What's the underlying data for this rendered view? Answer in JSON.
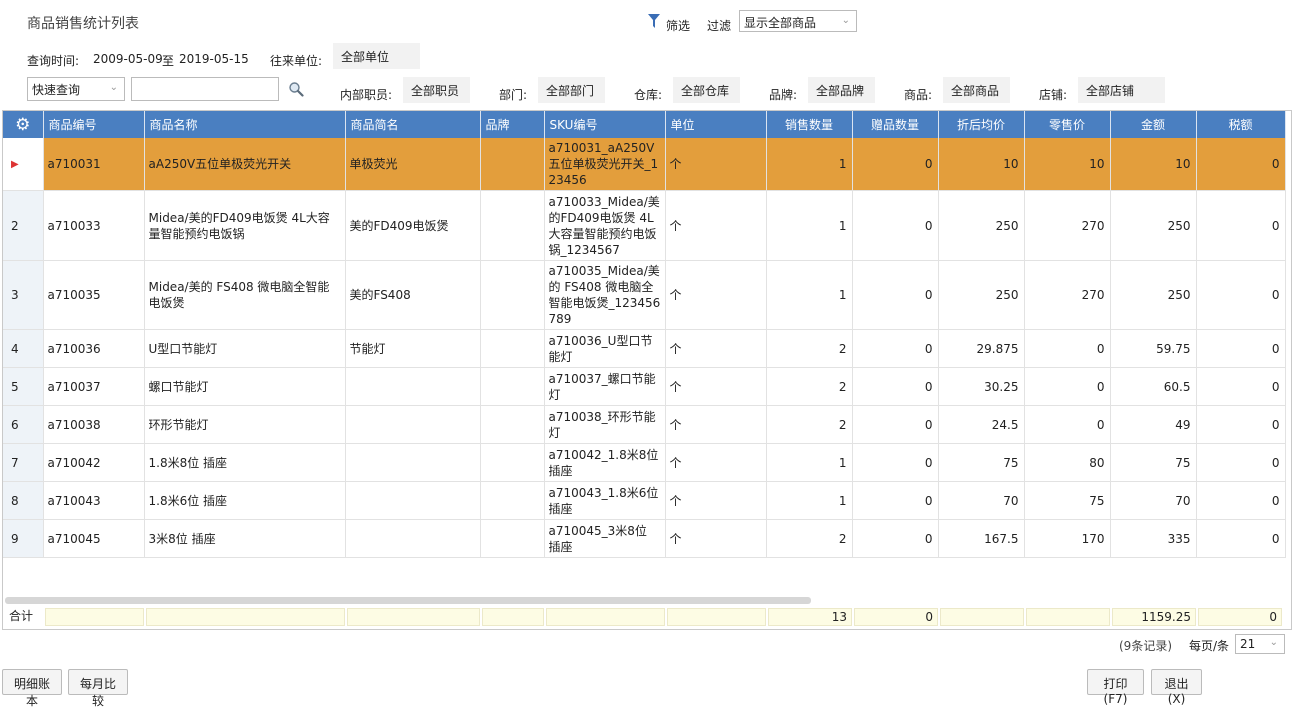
{
  "header": {
    "title": "商品销售统计列表",
    "filter_label": "筛选",
    "guolv_label": "过滤",
    "filter_select": "显示全部商品"
  },
  "query": {
    "time_label": "查询时间:",
    "date_from": "2009-05-09",
    "to_label": "至",
    "date_to": "2019-05-15",
    "partner_label": "往来单位:",
    "partner_value": "全部单位",
    "quick_select": "快速查询",
    "quick_input": "",
    "staff_label": "内部职员:",
    "staff_value": "全部职员",
    "dept_label": "部门:",
    "dept_value": "全部部门",
    "warehouse_label": "仓库:",
    "warehouse_value": "全部仓库",
    "brand_label": "品牌:",
    "brand_value": "全部品牌",
    "product_label": "商品:",
    "product_value": "全部商品",
    "store_label": "店铺:",
    "store_value": "全部店铺"
  },
  "table": {
    "columns": [
      "商品编号",
      "商品名称",
      "商品简名",
      "品牌",
      "SKU编号",
      "单位",
      "销售数量",
      "赠品数量",
      "折后均价",
      "零售价",
      "金额",
      "税额"
    ],
    "rows": [
      {
        "no": "",
        "code": "a710031",
        "name": "aA250V五位单极荧光开关",
        "short": "单极荧光",
        "brand": "",
        "sku": "a710031_aA250V五位单极荧光开关_123456",
        "unit": "个",
        "qty": "1",
        "gift": "0",
        "avg": "10",
        "retail": "10",
        "amount": "10",
        "tax": "0"
      },
      {
        "no": "2",
        "code": "a710033",
        "name": "Midea/美的FD409电饭煲 4L大容量智能预约电饭锅",
        "short": "美的FD409电饭煲",
        "brand": "",
        "sku": "a710033_Midea/美的FD409电饭煲 4L大容量智能预约电饭锅_1234567",
        "unit": "个",
        "qty": "1",
        "gift": "0",
        "avg": "250",
        "retail": "270",
        "amount": "250",
        "tax": "0"
      },
      {
        "no": "3",
        "code": "a710035",
        "name": "Midea/美的 FS408 微电脑全智能电饭煲",
        "short": "美的FS408",
        "brand": "",
        "sku": "a710035_Midea/美的 FS408 微电脑全智能电饭煲_123456789",
        "unit": "个",
        "qty": "1",
        "gift": "0",
        "avg": "250",
        "retail": "270",
        "amount": "250",
        "tax": "0"
      },
      {
        "no": "4",
        "code": "a710036",
        "name": "U型口节能灯",
        "short": "节能灯",
        "brand": "",
        "sku": "a710036_U型口节能灯",
        "unit": "个",
        "qty": "2",
        "gift": "0",
        "avg": "29.875",
        "retail": "0",
        "amount": "59.75",
        "tax": "0"
      },
      {
        "no": "5",
        "code": "a710037",
        "name": "螺口节能灯",
        "short": "",
        "brand": "",
        "sku": "a710037_螺口节能灯",
        "unit": "个",
        "qty": "2",
        "gift": "0",
        "avg": "30.25",
        "retail": "0",
        "amount": "60.5",
        "tax": "0"
      },
      {
        "no": "6",
        "code": "a710038",
        "name": "环形节能灯",
        "short": "",
        "brand": "",
        "sku": "a710038_环形节能灯",
        "unit": "个",
        "qty": "2",
        "gift": "0",
        "avg": "24.5",
        "retail": "0",
        "amount": "49",
        "tax": "0"
      },
      {
        "no": "7",
        "code": "a710042",
        "name": "1.8米8位 插座",
        "short": "",
        "brand": "",
        "sku": "a710042_1.8米8位插座",
        "unit": "个",
        "qty": "1",
        "gift": "0",
        "avg": "75",
        "retail": "80",
        "amount": "75",
        "tax": "0"
      },
      {
        "no": "8",
        "code": "a710043",
        "name": "1.8米6位 插座",
        "short": "",
        "brand": "",
        "sku": "a710043_1.8米6位插座",
        "unit": "个",
        "qty": "1",
        "gift": "0",
        "avg": "70",
        "retail": "75",
        "amount": "70",
        "tax": "0"
      },
      {
        "no": "9",
        "code": "a710045",
        "name": "3米8位 插座",
        "short": "",
        "brand": "",
        "sku": "a710045_3米8位 插座",
        "unit": "个",
        "qty": "2",
        "gift": "0",
        "avg": "167.5",
        "retail": "170",
        "amount": "335",
        "tax": "0"
      }
    ],
    "selected_row": 0,
    "selected_color": "#e39e3c",
    "header_color": "#4a7fc1"
  },
  "totals": {
    "label": "合计",
    "qty": "13",
    "gift": "0",
    "amount": "1159.25",
    "tax": "0"
  },
  "footer": {
    "records": "(9条记录)",
    "perpage_label": "每页/条",
    "perpage_value": "21"
  },
  "buttons": {
    "detail": "明细账本",
    "monthly": "每月比较",
    "print": "打印(F7)",
    "exit": "退出(X)"
  }
}
